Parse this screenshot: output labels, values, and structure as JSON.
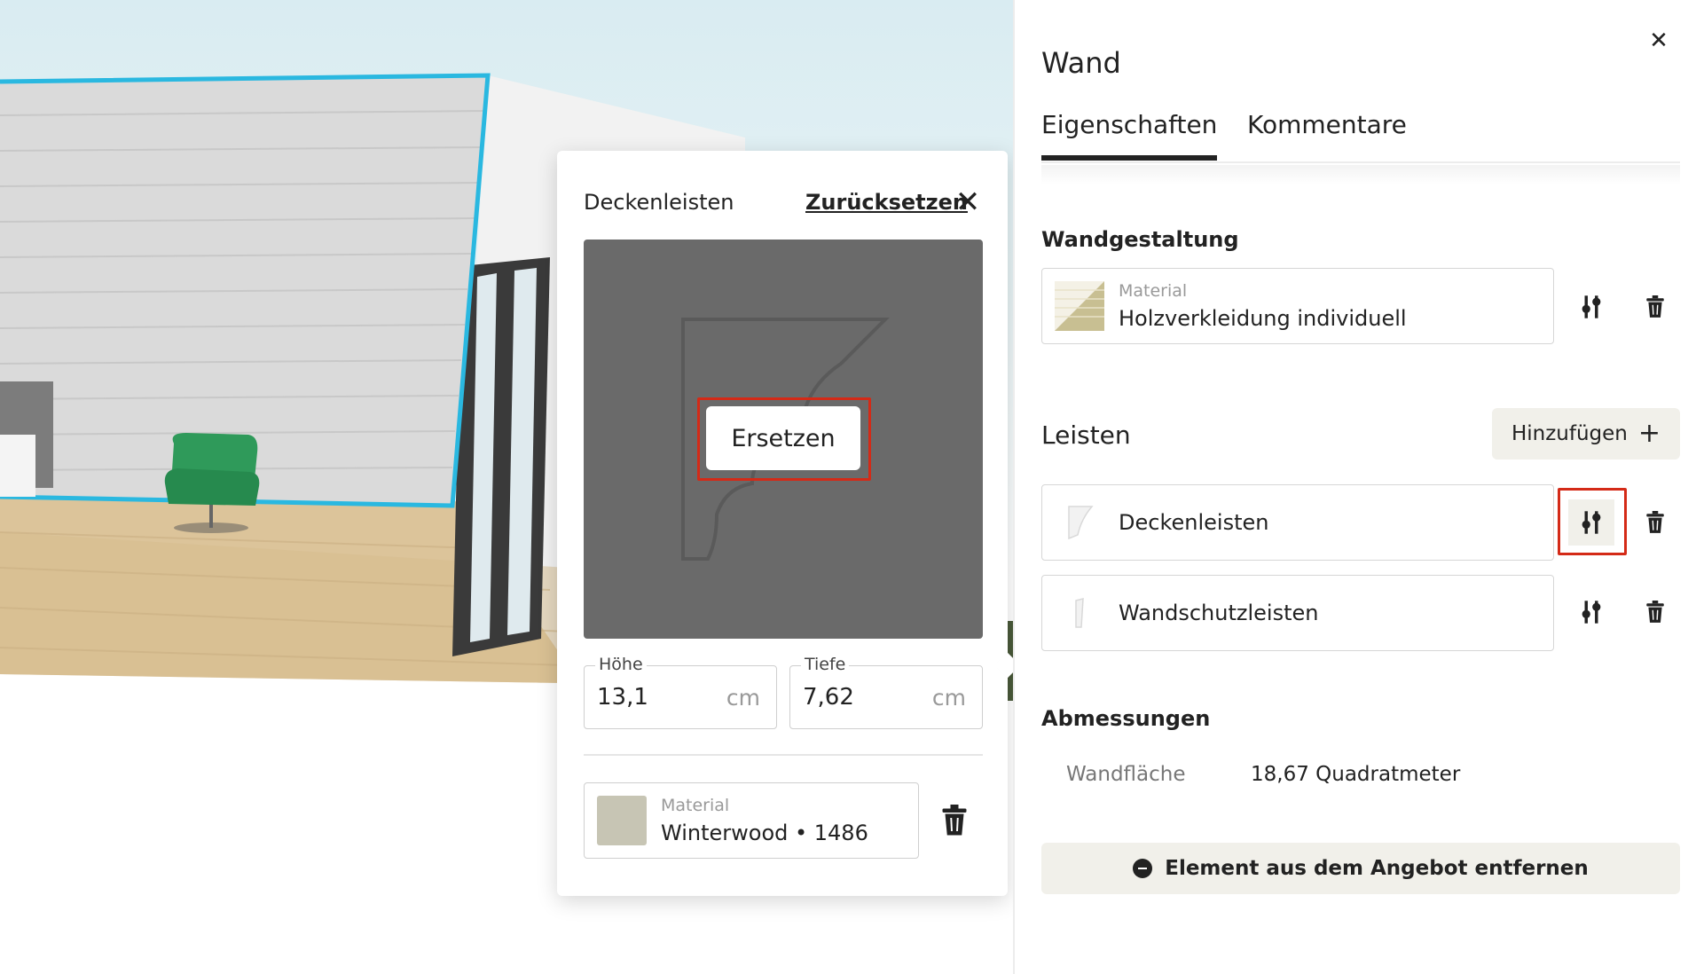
{
  "popup": {
    "title": "Deckenleisten",
    "reset_label": "Zurücksetzen",
    "close_glyph": "✕",
    "replace_label": "Ersetzen",
    "height": {
      "label": "Höhe",
      "value": "13,1",
      "unit": "cm"
    },
    "depth": {
      "label": "Tiefe",
      "value": "7,62",
      "unit": "cm"
    },
    "material": {
      "label": "Material",
      "value": "Winterwood • 1486",
      "swatch_color": "#c7c5b4"
    }
  },
  "panel": {
    "title": "Wand",
    "close_glyph": "✕",
    "tabs": [
      {
        "label": "Eigenschaften",
        "active": true
      },
      {
        "label": "Kommentare",
        "active": false
      }
    ],
    "wall_design": {
      "title": "Wandgestaltung",
      "material_label": "Material",
      "material_value": "Holzverkleidung individuell"
    },
    "moldings": {
      "title": "Leisten",
      "add_label": "Hinzufügen",
      "add_glyph": "+",
      "items": [
        {
          "label": "Deckenleisten"
        },
        {
          "label": "Wandschutzleisten"
        }
      ]
    },
    "dimensions": {
      "title": "Abmessungen",
      "rows": [
        {
          "label": "Wandfläche",
          "value": "18,67 Quadratmeter"
        }
      ]
    },
    "remove_label": "Element aus dem Angebot entfernen"
  },
  "colors": {
    "highlight": "#d42a17",
    "selection": "#2ab8e0",
    "button_bg": "#f1f0ea",
    "floor": "#dcc49a"
  }
}
